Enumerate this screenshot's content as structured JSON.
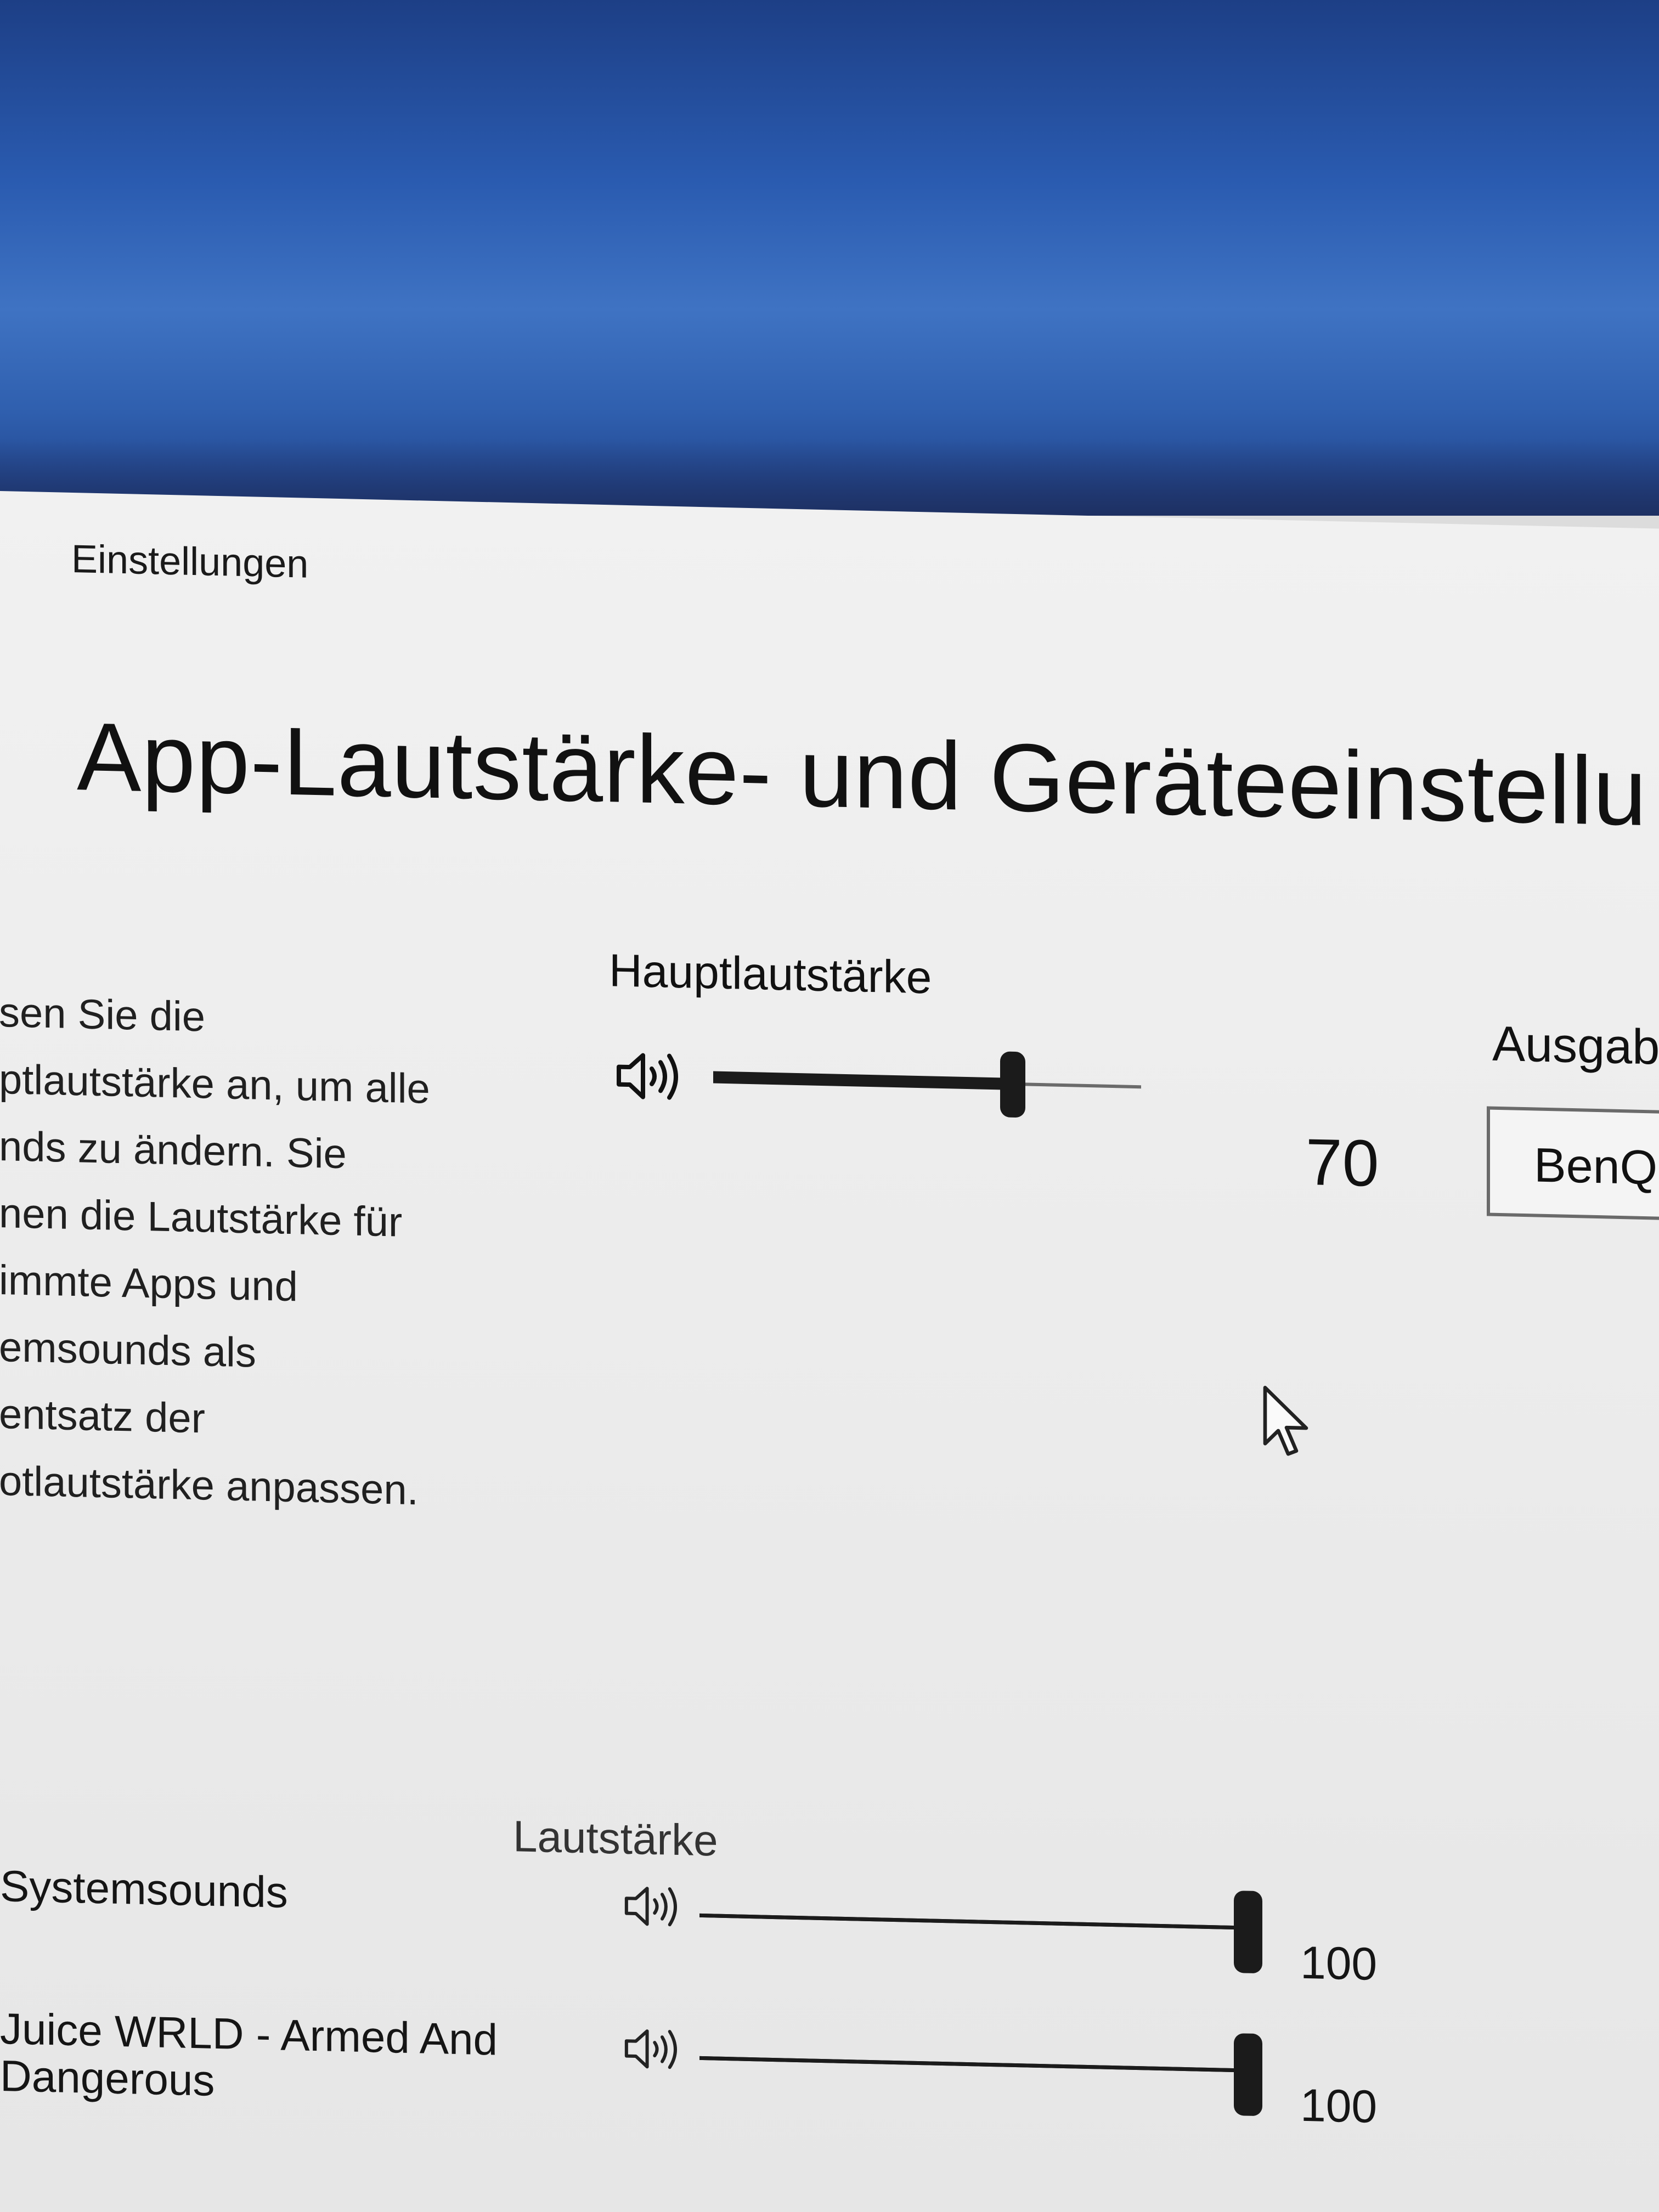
{
  "window": {
    "title": "Einstellungen"
  },
  "page": {
    "title": "App-Lautstärke- und Geräteeinstellu",
    "description_lines": [
      "sen Sie die",
      "ptlautstärke an, um alle",
      "nds zu ändern. Sie",
      "nen die Lautstärke für",
      "immte Apps und",
      "emsounds als",
      "entsatz der",
      "otlautstärke anpassen."
    ]
  },
  "master": {
    "label": "Hauptlautstärke",
    "value": "70",
    "level_percent": 70,
    "icon": "speaker-icon"
  },
  "output": {
    "label": "Ausgab",
    "selected": "BenQ"
  },
  "apps": {
    "column_header": "Lautstärke",
    "items": [
      {
        "name": "Systemsounds",
        "value": "100",
        "level_percent": 100
      },
      {
        "name": "Juice WRLD - Armed And Dangerous",
        "name_line1": "Juice WRLD - Armed And",
        "name_line2": "Dangerous",
        "value": "100",
        "level_percent": 100
      }
    ]
  }
}
